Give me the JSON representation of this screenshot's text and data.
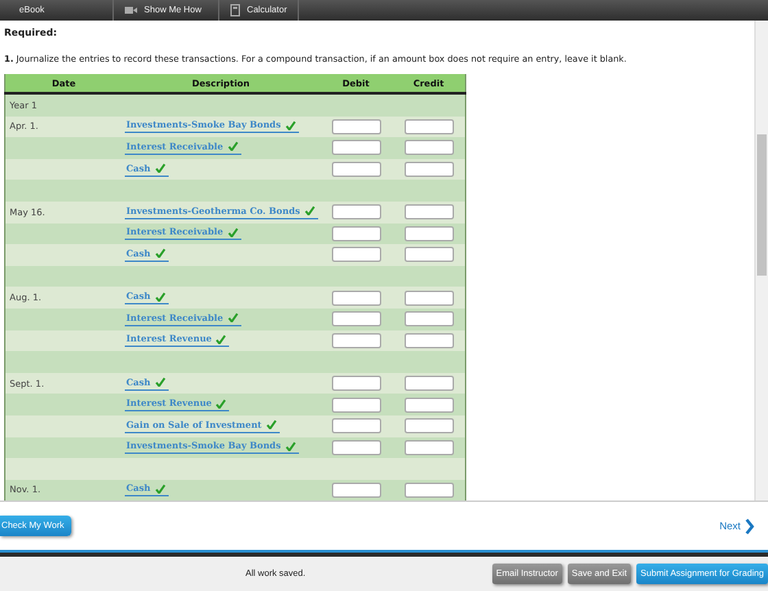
{
  "toolbar": {
    "items": [
      {
        "label": "eBook",
        "kind": "text"
      },
      {
        "label": "Show Me How",
        "kind": "video"
      },
      {
        "label": "Calculator",
        "kind": "calculator"
      }
    ]
  },
  "heading": "Required:",
  "instruction": "**1.** Journalize the entries to record these transactions. For a compound transaction, if an amount box does not require an entry, leave it blank.",
  "table": {
    "columns": [
      "Date",
      "Description",
      "Debit",
      "Credit"
    ],
    "year": "Year 1",
    "entries": [
      {
        "date": "Apr. 1.",
        "lines": [
          {
            "account": "Investments-Smoke Bay Bonds",
            "correct": true
          },
          {
            "account": "Interest Receivable",
            "correct": true
          },
          {
            "account": "Cash",
            "correct": true
          }
        ]
      },
      {
        "date": "May 16.",
        "lines": [
          {
            "account": "Investments-Geotherma Co. Bonds",
            "correct": true
          },
          {
            "account": "Interest Receivable",
            "correct": true
          },
          {
            "account": "Cash",
            "correct": true
          }
        ]
      },
      {
        "date": "Aug. 1.",
        "lines": [
          {
            "account": "Cash",
            "correct": true
          },
          {
            "account": "Interest Receivable",
            "correct": true
          },
          {
            "account": "Interest Revenue",
            "correct": true
          }
        ]
      },
      {
        "date": "Sept. 1.",
        "lines": [
          {
            "account": "Cash",
            "correct": true
          },
          {
            "account": "Interest Revenue",
            "correct": true
          },
          {
            "account": "Gain on Sale of Investment",
            "correct": true
          },
          {
            "account": "Investments-Smoke Bay Bonds",
            "correct": true
          }
        ]
      },
      {
        "date": "Nov. 1.",
        "lines": [
          {
            "account": "Cash",
            "correct": true
          }
        ]
      }
    ]
  },
  "check_button": "Check My Work",
  "next_link": "Next",
  "status": "All work saved.",
  "footer_buttons": [
    {
      "label": "Email Instructor",
      "kind": "secondary"
    },
    {
      "label": "Save and Exit",
      "kind": "secondary"
    },
    {
      "label": "Submit Assignment for Grading",
      "kind": "primary"
    }
  ]
}
